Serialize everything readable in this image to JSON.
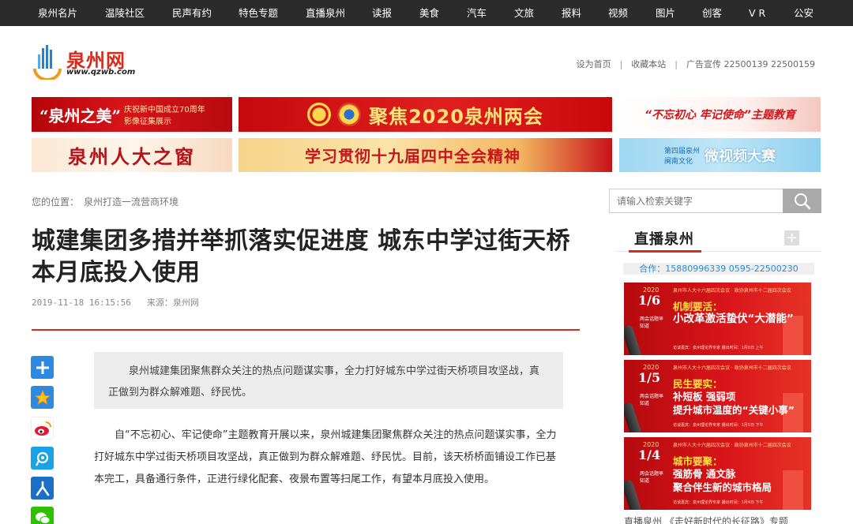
{
  "nav": {
    "items": [
      "泉州名片",
      "温陵社区",
      "民声有约",
      "特色专题",
      "直播泉州",
      "读报",
      "美食",
      "汽车",
      "文旅",
      "报料",
      "视频",
      "图片",
      "创客",
      "V R",
      "公安"
    ]
  },
  "header": {
    "logo_cn": "泉州网",
    "logo_en": "www.qzwb.com",
    "links": {
      "home": "设为首页",
      "fav": "收藏本站",
      "ads": "广告宣传 22500139 22500159"
    },
    "sep": "|"
  },
  "banners": {
    "b1": {
      "main": "“泉州之美”",
      "sub1": "庆祝新中国成立70周年",
      "sub2": "影像征集展示"
    },
    "b2": {
      "text": "聚焦2020泉州两会"
    },
    "b3": {
      "text": "“不忘初心 牢记使命”主题教育"
    },
    "b4": {
      "text": "泉州人大之窗"
    },
    "b5": {
      "text": "学习贯彻十九届四中全会精神"
    },
    "b6": {
      "top": "第四届泉州",
      "bot": "闽南文化",
      "big": "微视频大赛"
    }
  },
  "breadcrumb": {
    "label": "您的位置：",
    "path": "泉州打造一流营商环境"
  },
  "search": {
    "placeholder": "请输入检索关键字"
  },
  "article": {
    "title": "城建集团多措并举抓落实促进度 城东中学过街天桥本月底投入使用",
    "date": "2019-11-18 16:15:56",
    "source": "来源：泉州网",
    "summary": "泉州城建集团聚焦群众关注的热点问题谋实事，全力打好城东中学过街天桥项目攻坚战，真正做到为群众解难题、纾民忧。",
    "body": "自“不忘初心、牢记使命”主题教育开展以来，泉州城建集团聚焦群众关注的热点问题谋实事，全力打好城东中学过街天桥项目攻坚战，真正做到为群众解难题、纾民忧。目前，该天桥桥面铺设工作已基本完工，具备通行条件，正进行绿化配套、夜景布置等扫尾工作，有望本月底投入使用。"
  },
  "sidebar": {
    "live_title": "直播泉州",
    "contact": "合作：15880996339 0595-22500230",
    "cards": [
      {
        "year": "2020",
        "date": "1/6",
        "tag": "两会话题早知道",
        "top": "泉州市人大十六届四次会议 · 政协泉州市十二届四次会议",
        "head": "机制要活：",
        "sub": "小改革激活蛰伏“大潜能”",
        "foot": "访谈嘉宾：泉州理论界专家   播出时间：1月6日 上午"
      },
      {
        "year": "2020",
        "date": "1/5",
        "tag": "两会话题早知道",
        "top": "泉州市人大十六届四次会议 · 政协泉州市十二届四次会议",
        "head": "民生要实：",
        "sub": "补短板 强弱项\n提升城市温度的“关键小事”",
        "foot": "访谈嘉宾：泉州理论界专家   播出时间：1月5日 下午"
      },
      {
        "year": "2020",
        "date": "1/4",
        "tag": "两会话题早知道",
        "top": "泉州市人大十六届四次会议 · 政协泉州市十二届四次会议",
        "head": "城市要聚：",
        "sub": "强筋骨 通文脉\n聚合伴生新的城市格局",
        "foot": "访谈嘉宾：泉州理论界专家   播出时间：1月4日 下午"
      }
    ],
    "bottom_text": "直播泉州 《走好新时代的长征路》专题"
  },
  "share": {
    "icons": [
      "add-icon",
      "favorite-star-icon",
      "weibo-icon",
      "qq-weibo-icon",
      "renren-icon",
      "wechat-icon"
    ]
  },
  "colors": {
    "brand_red": "#d62b21",
    "nav_bg": "#2b2b2b",
    "link_blue": "#2a8ad6"
  }
}
